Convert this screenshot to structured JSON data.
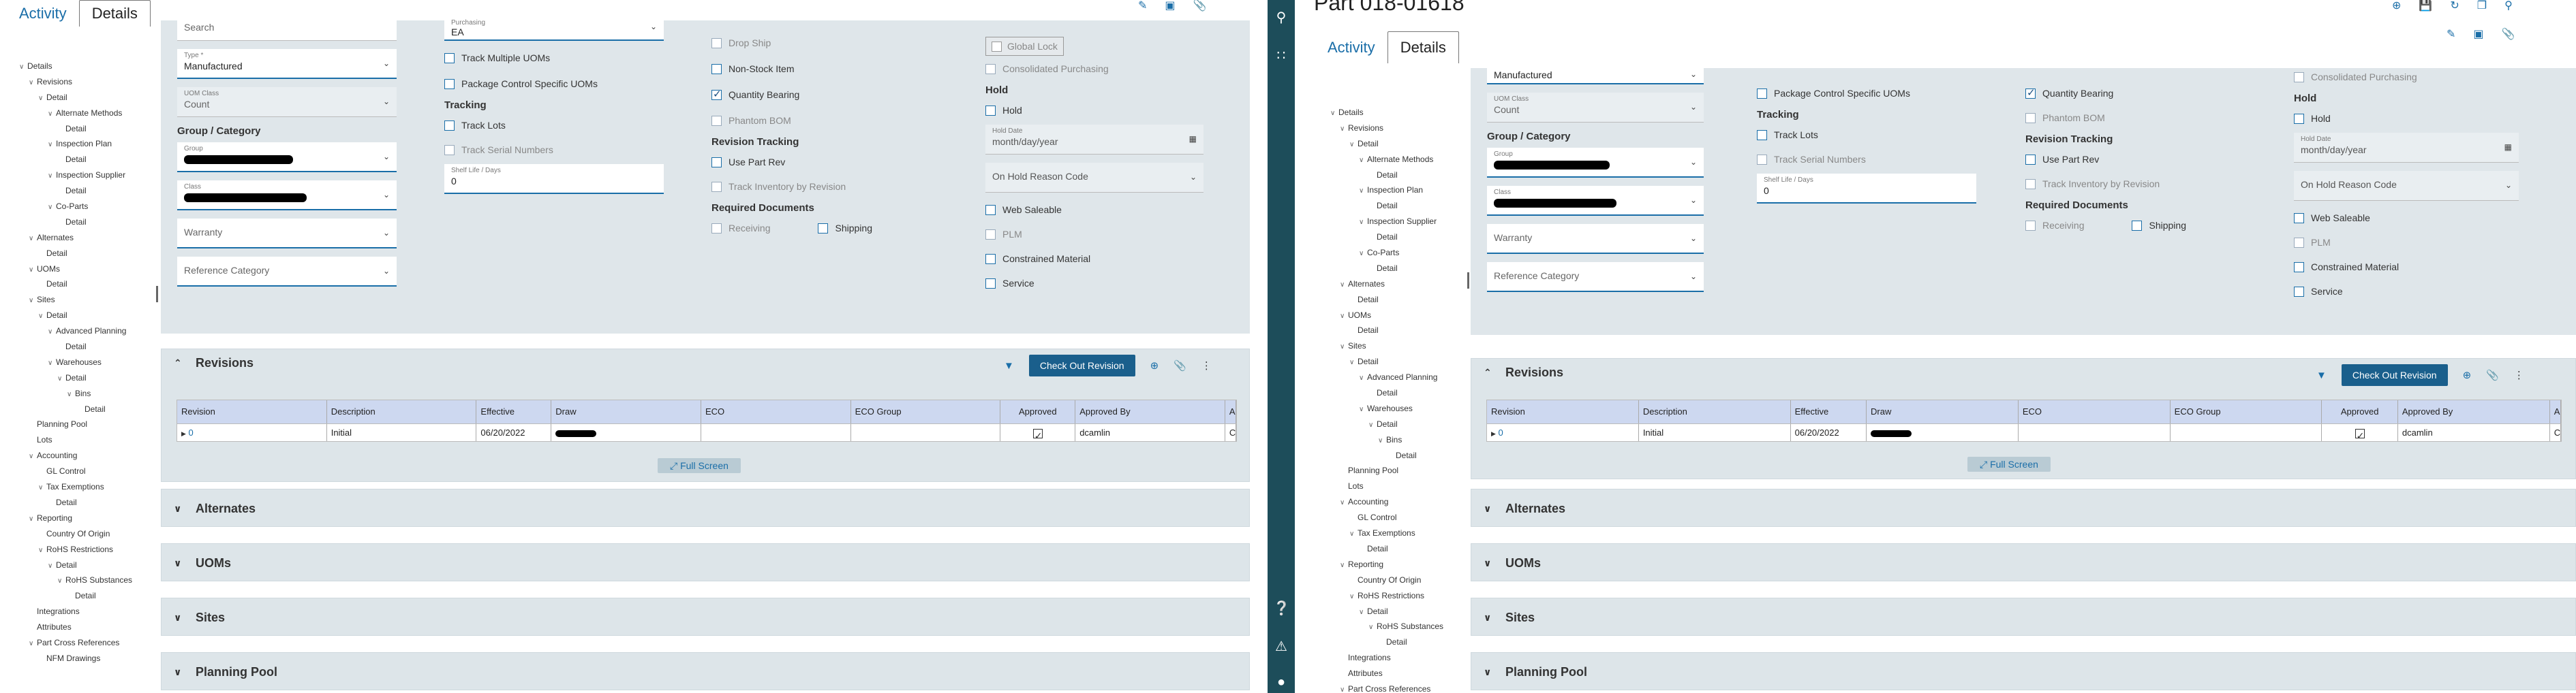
{
  "tabs": {
    "activity": "Activity",
    "details": "Details"
  },
  "right_title": "Part 018-01618",
  "icons": {
    "top_left": [
      "note-icon",
      "layout-icon",
      "paperclip-icon"
    ],
    "top_right": [
      "add-circle-icon",
      "save-icon",
      "refresh-icon",
      "copy-icon",
      "search-icon"
    ],
    "tab_right": [
      "note-icon",
      "layout-icon",
      "paperclip-icon"
    ],
    "sidebar": [
      "search-icon",
      "apps-grid-icon",
      "help-icon",
      "bell-icon",
      "user-icon"
    ]
  },
  "tree": [
    {
      "label": "Details",
      "level": 0,
      "toggle": "v"
    },
    {
      "label": "Revisions",
      "level": 1,
      "toggle": "v"
    },
    {
      "label": "Detail",
      "level": 2,
      "toggle": "v"
    },
    {
      "label": "Alternate Methods",
      "level": 3,
      "toggle": "v"
    },
    {
      "label": "Detail",
      "level": 4,
      "toggle": ""
    },
    {
      "label": "Inspection Plan",
      "level": 3,
      "toggle": "v"
    },
    {
      "label": "Detail",
      "level": 4,
      "toggle": ""
    },
    {
      "label": "Inspection Supplier",
      "level": 3,
      "toggle": "v"
    },
    {
      "label": "Detail",
      "level": 4,
      "toggle": ""
    },
    {
      "label": "Co-Parts",
      "level": 3,
      "toggle": "v"
    },
    {
      "label": "Detail",
      "level": 4,
      "toggle": ""
    },
    {
      "label": "Alternates",
      "level": 1,
      "toggle": "v"
    },
    {
      "label": "Detail",
      "level": 2,
      "toggle": ""
    },
    {
      "label": "UOMs",
      "level": 1,
      "toggle": "v"
    },
    {
      "label": "Detail",
      "level": 2,
      "toggle": ""
    },
    {
      "label": "Sites",
      "level": 1,
      "toggle": "v"
    },
    {
      "label": "Detail",
      "level": 2,
      "toggle": "v"
    },
    {
      "label": "Advanced Planning",
      "level": 3,
      "toggle": "v"
    },
    {
      "label": "Detail",
      "level": 4,
      "toggle": ""
    },
    {
      "label": "Warehouses",
      "level": 3,
      "toggle": "v"
    },
    {
      "label": "Detail",
      "level": 4,
      "toggle": "v"
    },
    {
      "label": "Bins",
      "level": 5,
      "toggle": "v"
    },
    {
      "label": "Detail",
      "level": 6,
      "toggle": ""
    },
    {
      "label": "Planning Pool",
      "level": 1,
      "toggle": ""
    },
    {
      "label": "Lots",
      "level": 1,
      "toggle": ""
    },
    {
      "label": "Accounting",
      "level": 1,
      "toggle": "v"
    },
    {
      "label": "GL Control",
      "level": 2,
      "toggle": ""
    },
    {
      "label": "Tax Exemptions",
      "level": 2,
      "toggle": "v"
    },
    {
      "label": "Detail",
      "level": 3,
      "toggle": ""
    },
    {
      "label": "Reporting",
      "level": 1,
      "toggle": "v"
    },
    {
      "label": "Country Of Origin",
      "level": 2,
      "toggle": ""
    },
    {
      "label": "RoHS Restrictions",
      "level": 2,
      "toggle": "v"
    },
    {
      "label": "Detail",
      "level": 3,
      "toggle": "v"
    },
    {
      "label": "RoHS Substances",
      "level": 4,
      "toggle": "v"
    },
    {
      "label": "Detail",
      "level": 5,
      "toggle": ""
    },
    {
      "label": "Integrations",
      "level": 1,
      "toggle": ""
    },
    {
      "label": "Attributes",
      "level": 1,
      "toggle": ""
    },
    {
      "label": "Part Cross References",
      "level": 1,
      "toggle": "v"
    },
    {
      "label": "NFM Drawings",
      "level": 2,
      "toggle": ""
    }
  ],
  "form": {
    "search_placeholder": "Search",
    "type": {
      "label": "Type *",
      "value": "Manufactured"
    },
    "uom_class": {
      "label": "UOM Class",
      "value": "Count"
    },
    "group_category_title": "Group / Category",
    "group_label": "Group",
    "class_label": "Class",
    "warranty_placeholder": "Warranty",
    "reference_category_placeholder": "Reference Category",
    "purchasing": {
      "label": "Purchasing",
      "value": "EA"
    },
    "track_multiple_uoms": "Track Multiple UOMs",
    "package_control": "Package Control Specific UOMs",
    "tracking_title": "Tracking",
    "track_lots": "Track Lots",
    "track_serial": "Track Serial Numbers",
    "shelf_life": {
      "label": "Shelf Life / Days",
      "value": "0"
    },
    "drop_ship": "Drop Ship",
    "non_stock": "Non-Stock Item",
    "quantity_bearing": "Quantity Bearing",
    "phantom_bom": "Phantom BOM",
    "revision_tracking_title": "Revision Tracking",
    "use_part_rev": "Use Part Rev",
    "track_inventory_by_revision": "Track Inventory by Revision",
    "required_documents_title": "Required Documents",
    "receiving": "Receiving",
    "shipping": "Shipping",
    "global_lock": "Global Lock",
    "consolidated_purchasing": "Consolidated Purchasing",
    "hold_title": "Hold",
    "hold": "Hold",
    "hold_date": {
      "label": "Hold Date",
      "placeholder": "month/day/year"
    },
    "on_hold_reason": "On Hold Reason Code",
    "web_saleable": "Web Saleable",
    "plm": "PLM",
    "constrained_material": "Constrained Material",
    "service": "Service"
  },
  "revisions": {
    "title": "Revisions",
    "check_out": "Check Out Revision",
    "columns": [
      "Revision",
      "Description",
      "Effective",
      "Draw",
      "ECO",
      "ECO Group",
      "Approved",
      "Approved By",
      "A"
    ],
    "rows": [
      {
        "revision": "0",
        "description": "Initial",
        "effective": "06/20/2022",
        "eco": "",
        "eco_group": "",
        "approved_by": "dcamlin",
        "extra": "C"
      }
    ],
    "full_screen": "Full Screen"
  },
  "sections": [
    "Alternates",
    "UOMs",
    "Sites",
    "Planning Pool"
  ],
  "colors": {
    "accent": "#1a6ea8",
    "sidebar": "#1d4d5a",
    "button": "#1a5f8c",
    "content_bg": "#dfe6ea",
    "grid_header": "#cdd8f0"
  }
}
